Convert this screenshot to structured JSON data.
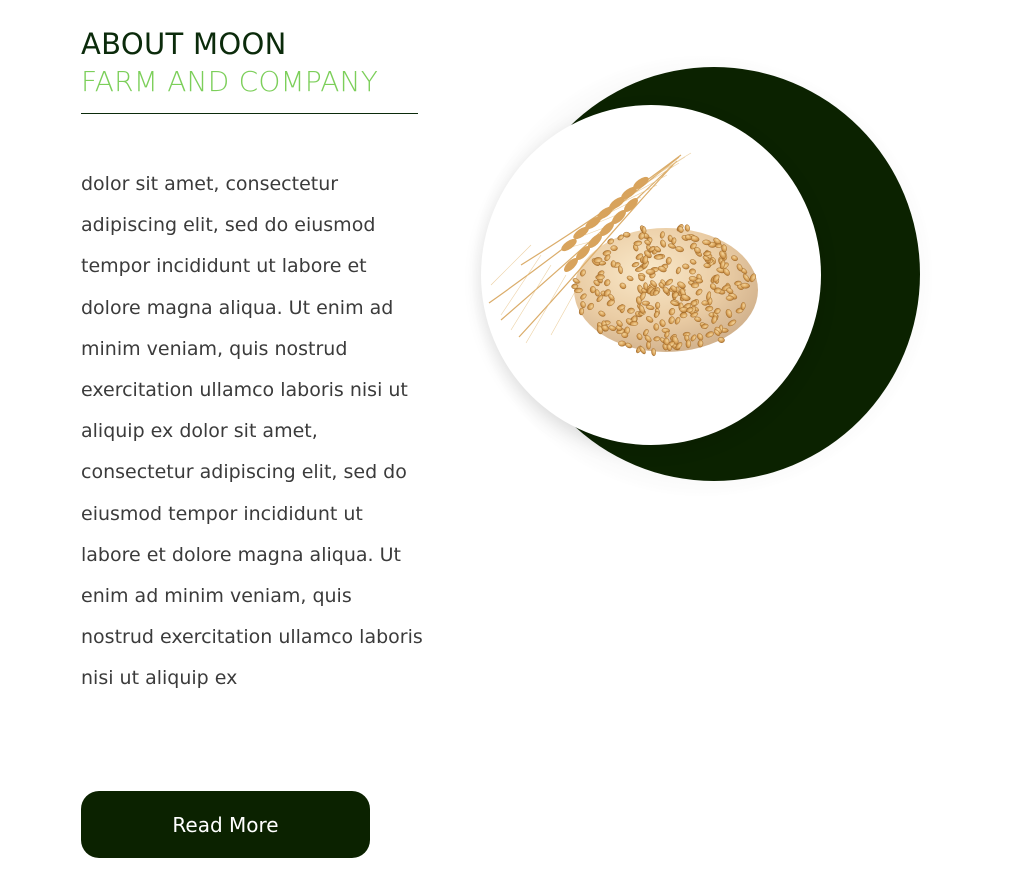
{
  "about": {
    "title": "ABOUT MOON",
    "subtitle": "FARM AND COMPANY",
    "body": "dolor sit amet, consectetur adipiscing elit, sed do eiusmod tempor incididunt ut labore et dolore magna aliqua. Ut enim ad minim veniam, quis nostrud exercitation ullamco laboris nisi ut aliquip ex dolor sit amet, consectetur adipiscing elit, sed do eiusmod tempor incididunt ut labore et dolore magna aliqua. Ut enim ad minim veniam, quis nostrud exercitation ullamco laboris nisi ut aliquip ex",
    "button_label": "Read More"
  },
  "image": {
    "icon": "wheat-grain-image"
  },
  "colors": {
    "dark_green": "#0b2200",
    "title_green": "#0b2b0b",
    "light_green": "#7ccf5a",
    "body_text": "#3b3b3b"
  }
}
